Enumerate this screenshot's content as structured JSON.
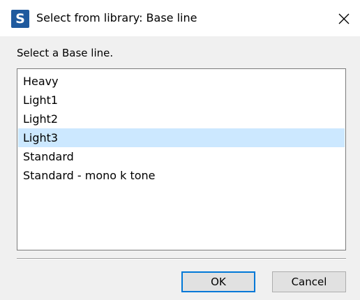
{
  "window": {
    "app_icon_letter": "S",
    "title": "Select from library: Base line",
    "close_glyph": "close-icon"
  },
  "prompt": "Select a Base line.",
  "list": {
    "items": [
      {
        "label": "Heavy",
        "selected": false
      },
      {
        "label": "Light1",
        "selected": false
      },
      {
        "label": "Light2",
        "selected": false
      },
      {
        "label": "Light3",
        "selected": true
      },
      {
        "label": "Standard",
        "selected": false
      },
      {
        "label": "Standard - mono k tone",
        "selected": false
      }
    ]
  },
  "buttons": {
    "ok_label": "OK",
    "cancel_label": "Cancel"
  },
  "colors": {
    "selection": "#cce8ff",
    "app_icon": "#1f5a9e",
    "default_button_border": "#0078d7"
  }
}
